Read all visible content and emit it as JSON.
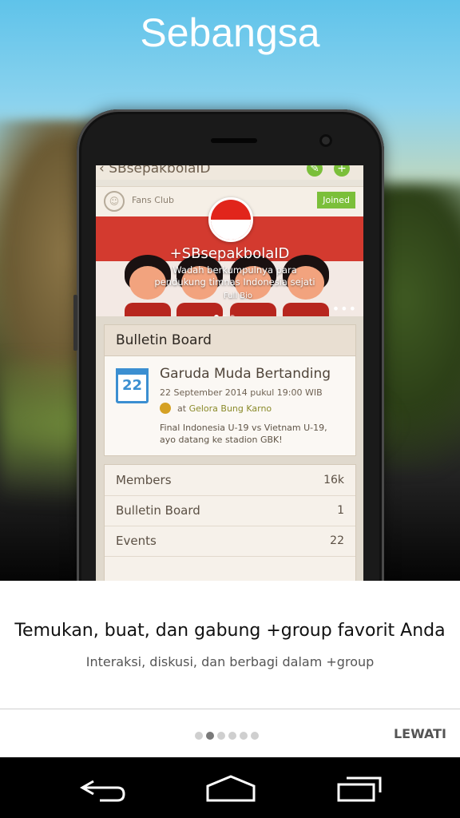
{
  "app_title": "Sebangsa",
  "phone_screen": {
    "group_title": "SBsepakbolaID",
    "category": "Fans Club",
    "joined_label": "Joined",
    "banner_title": "+SBsepakbolaID",
    "banner_subtitle": "Wadah berkumpulnya para pendukung timnas Indonesia sejati",
    "full_bio_label": "Full Bio",
    "bulletin": {
      "header": "Bulletin Board",
      "calendar_day": "22",
      "event_title": "Garuda Muda Bertanding",
      "event_datetime": "22 September 2014 pukul 19:00 WIB",
      "at_label": "at",
      "event_location": "Gelora Bung Karno",
      "event_description": "Final Indonesia U-19 vs Vietnam U-19, ayo datang ke stadion GBK!"
    },
    "stats": [
      {
        "label": "Members",
        "value": "16k"
      },
      {
        "label": "Bulletin Board",
        "value": "1"
      },
      {
        "label": "Events",
        "value": "22"
      }
    ]
  },
  "onboarding": {
    "headline": "Temukan, buat, dan gabung +group favorit Anda",
    "subline": "Interaksi, diskusi, dan berbagi dalam +group",
    "page_count": 6,
    "current_page": 2,
    "skip_label": "LEWATI"
  },
  "navbar": {
    "icons": [
      "back-icon",
      "home-icon",
      "recent-apps-icon"
    ]
  },
  "colors": {
    "accent_red": "#d33a2f",
    "accent_green": "#7bbf3a",
    "calendar_blue": "#3b8fd1"
  }
}
